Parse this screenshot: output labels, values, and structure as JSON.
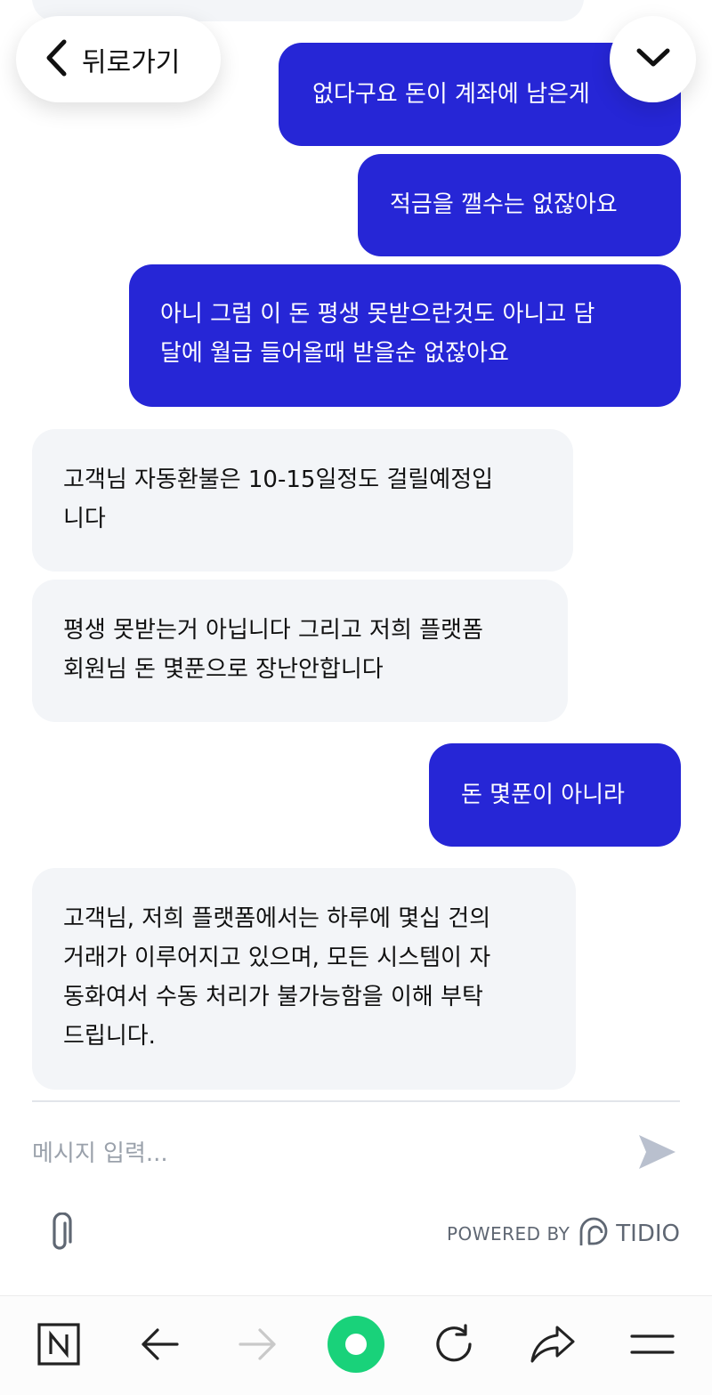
{
  "header": {
    "back_label": "뒤로가기",
    "back_icon": "chevron-left-icon",
    "scroll_icon": "chevron-down-icon"
  },
  "messages": [
    {
      "sender": "user",
      "lines": [
        "없다구요 돈이 계좌에 남은게"
      ]
    },
    {
      "sender": "user",
      "lines": [
        "적금을 깰수는 없잖아요"
      ]
    },
    {
      "sender": "user",
      "lines": [
        "아니 그럼 이 돈 평생 못받으란것도 아니고 담",
        "달에 월급 들어올때 받을순 없잖아요"
      ]
    },
    {
      "sender": "agent",
      "lines": [
        "고객님 자동환불은 10-15일정도 걸릴예정입",
        "니다"
      ]
    },
    {
      "sender": "agent",
      "lines": [
        "평생 못받는거 아닙니다 그리고 저희 플랫폼",
        "회원님 돈 몇푼으로 장난안합니다"
      ]
    },
    {
      "sender": "user",
      "lines": [
        "돈 몇푼이 아니라"
      ]
    },
    {
      "sender": "agent",
      "lines": [
        "고객님, 저희 플랫폼에서는 하루에 몇십 건의",
        "거래가 이루어지고 있으며, 모든 시스템이 자",
        "동화여서 수동 처리가 불가능함을 이해 부탁",
        "드립니다."
      ]
    }
  ],
  "composer": {
    "placeholder": "메시지 입력...",
    "value": "",
    "send_icon": "send-icon",
    "attach_icon": "paperclip-icon"
  },
  "footer": {
    "powered_by": "POWERED BY",
    "brand": "TIDIO",
    "brand_icon": "tidio-logo-icon"
  },
  "browser_nav": {
    "icons": [
      "naver-n-icon",
      "back-arrow-icon",
      "forward-arrow-icon",
      "home-green-icon",
      "refresh-icon",
      "share-icon",
      "menu-icon"
    ]
  },
  "colors": {
    "user_bubble": "#2626d6",
    "agent_bubble": "#f3f5f8",
    "accent_green": "#19d27a",
    "muted_text": "#5f6773"
  }
}
